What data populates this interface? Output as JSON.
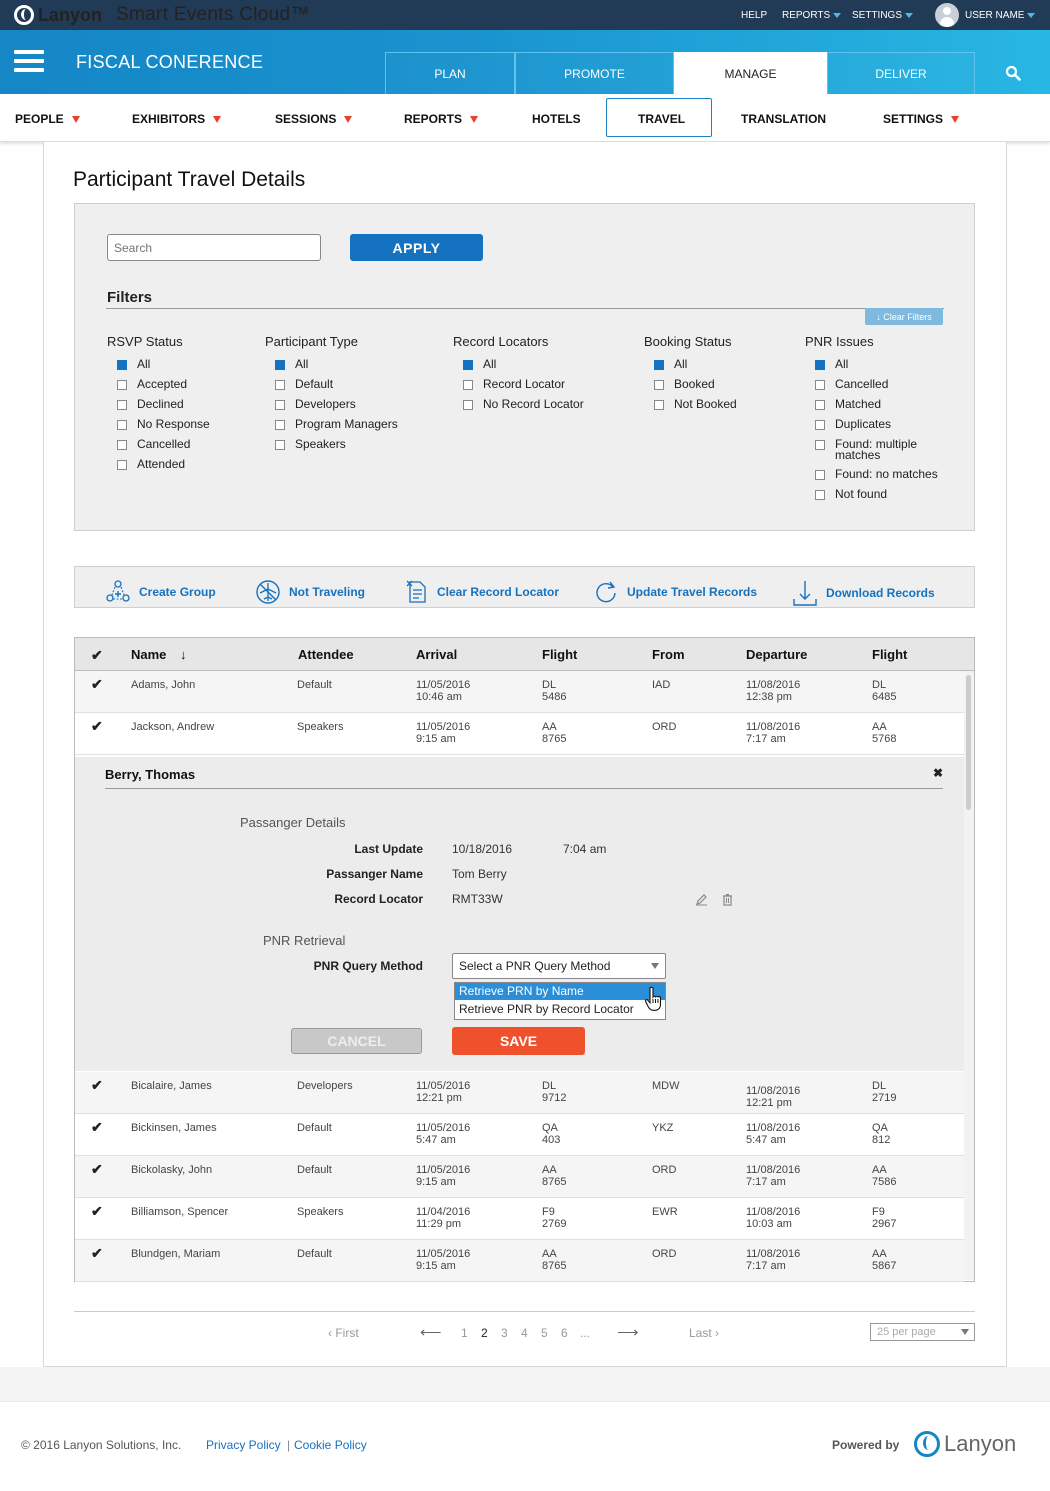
{
  "topbar": {
    "brand": "Lanyon",
    "product": "Smart Events Cloud™",
    "help": "HELP",
    "reports": "REPORTS",
    "settings": "SETTINGS",
    "user": "USER NAME"
  },
  "header": {
    "event_title": "FISCAL CONERENCE",
    "tabs": [
      {
        "label": "PLAN"
      },
      {
        "label": "PROMOTE"
      },
      {
        "label": "MANAGE",
        "active": true
      },
      {
        "label": "DELIVER"
      }
    ]
  },
  "subnav": {
    "items": [
      {
        "label": "PEOPLE",
        "dropdown": true
      },
      {
        "label": "EXHIBITORS",
        "dropdown": true
      },
      {
        "label": "SESSIONS",
        "dropdown": true
      },
      {
        "label": "REPORTS",
        "dropdown": true
      },
      {
        "label": "HOTELS",
        "dropdown": false
      },
      {
        "label": "TRAVEL",
        "dropdown": false,
        "active": true
      },
      {
        "label": "TRANSLATION",
        "dropdown": false
      },
      {
        "label": "SETTINGS",
        "dropdown": true
      }
    ]
  },
  "page": {
    "title": "Participant Travel Details"
  },
  "search": {
    "placeholder": "Search",
    "apply_label": "APPLY"
  },
  "filters": {
    "heading": "Filters",
    "clear_label": "↓ Clear Filters",
    "groups": [
      {
        "title": "RSVP Status",
        "options": [
          {
            "label": "All",
            "checked": true
          },
          {
            "label": "Accepted"
          },
          {
            "label": "Declined"
          },
          {
            "label": "No Response"
          },
          {
            "label": "Cancelled"
          },
          {
            "label": "Attended"
          }
        ]
      },
      {
        "title": "Participant Type",
        "options": [
          {
            "label": "All",
            "checked": true
          },
          {
            "label": "Default"
          },
          {
            "label": "Developers"
          },
          {
            "label": "Program Managers"
          },
          {
            "label": "Speakers"
          }
        ]
      },
      {
        "title": "Record Locators",
        "options": [
          {
            "label": "All",
            "checked": true
          },
          {
            "label": "Record Locator"
          },
          {
            "label": "No Record Locator"
          }
        ]
      },
      {
        "title": "Booking Status",
        "options": [
          {
            "label": "All",
            "checked": true
          },
          {
            "label": "Booked"
          },
          {
            "label": "Not Booked"
          }
        ]
      },
      {
        "title": "PNR Issues",
        "options": [
          {
            "label": "All",
            "checked": true
          },
          {
            "label": "Cancelled"
          },
          {
            "label": "Matched"
          },
          {
            "label": "Duplicates"
          },
          {
            "label": "Found: multiple matches"
          },
          {
            "label": "Found: no matches"
          },
          {
            "label": "Not found"
          }
        ]
      }
    ]
  },
  "actions": {
    "create_group": "Create Group",
    "not_traveling": "Not Traveling",
    "clear_record_locator": "Clear Record Locator",
    "update_travel_records": "Update Travel Records",
    "download_records": "Download Records"
  },
  "table": {
    "check_glyph": "✔",
    "columns": {
      "name": "Name",
      "attendee": "Attendee",
      "arrival": "Arrival",
      "flight": "Flight",
      "from": "From",
      "departure": "Departure",
      "flight2": "Flight"
    },
    "rows_top": [
      {
        "name": "Adams, John",
        "attendee": "Default",
        "arr_date": "11/05/2016",
        "arr_time": "10:46 am",
        "flt_code": "DL",
        "flt_num": "5486",
        "from": "IAD",
        "dep_date": "11/08/2016",
        "dep_time": "12:38 pm",
        "flt2_code": "DL",
        "flt2_num": "6485"
      },
      {
        "name": "Jackson, Andrew",
        "attendee": "Speakers",
        "arr_date": "11/05/2016",
        "arr_time": "9:15 am",
        "flt_code": "AA",
        "flt_num": "8765",
        "from": "ORD",
        "dep_date": "11/08/2016",
        "dep_time": "7:17 am",
        "flt2_code": "AA",
        "flt2_num": "5768"
      }
    ],
    "rows_bottom": [
      {
        "name": "Bicalaire, James",
        "attendee": "Developers",
        "arr_date": "11/05/2016",
        "arr_time": "12:21 pm",
        "flt_code": "DL",
        "flt_num": "9712",
        "from": "MDW",
        "dep_date": "11/08/2016",
        "dep_time": "12:21 pm",
        "flt2_code": "DL",
        "flt2_num": "2719"
      },
      {
        "name": "Bickinsen, James",
        "attendee": "Default",
        "arr_date": "11/05/2016",
        "arr_time": "5:47 am",
        "flt_code": "QA",
        "flt_num": "403",
        "from": "YKZ",
        "dep_date": "11/08/2016",
        "dep_time": "5:47 am",
        "flt2_code": "QA",
        "flt2_num": "812"
      },
      {
        "name": "Bickolasky, John",
        "attendee": "Default",
        "arr_date": "11/05/2016",
        "arr_time": "9:15 am",
        "flt_code": "AA",
        "flt_num": "8765",
        "from": "ORD",
        "dep_date": "11/08/2016",
        "dep_time": "7:17 am",
        "flt2_code": "AA",
        "flt2_num": "7586"
      },
      {
        "name": "Billiamson, Spencer",
        "attendee": "Speakers",
        "arr_date": "11/04/2016",
        "arr_time": "11:29 pm",
        "flt_code": "F9",
        "flt_num": "2769",
        "from": "EWR",
        "dep_date": "11/08/2016",
        "dep_time": "10:03 am",
        "flt2_code": "F9",
        "flt2_num": "2967"
      },
      {
        "name": "Blundgen, Mariam",
        "attendee": "Default",
        "arr_date": "11/05/2016",
        "arr_time": "9:15 am",
        "flt_code": "AA",
        "flt_num": "8765",
        "from": "ORD",
        "dep_date": "11/08/2016",
        "dep_time": "7:17 am",
        "flt2_code": "AA",
        "flt2_num": "5867"
      }
    ]
  },
  "detail": {
    "name": "Berry, Thomas",
    "close_glyph": "✖",
    "passenger_heading": "Passanger Details",
    "last_update_label": "Last Update",
    "last_update_date": "10/18/2016",
    "last_update_time": "7:04 am",
    "passenger_name_label": "Passanger Name",
    "passenger_name": "Tom Berry",
    "record_locator_label": "Record Locator",
    "record_locator": "RMT33W",
    "pnr_heading": "PNR Retrieval",
    "pnr_method_label": "PNR Query Method",
    "pnr_select_value": "Select a PNR Query Method",
    "pnr_options": [
      "Retrieve PRN by Name",
      "Retrieve PNR by Record Locator"
    ],
    "cancel_label": "CANCEL",
    "save_label": "SAVE"
  },
  "pagination": {
    "first": "First",
    "last": "Last",
    "pages": [
      "1",
      "2",
      "3",
      "4",
      "5",
      "6",
      "..."
    ],
    "current": "2",
    "per_page": "25 per page"
  },
  "footer": {
    "copyright": "© 2016 Lanyon Solutions, Inc.",
    "privacy": "Privacy Policy",
    "separator": "|",
    "cookie": "Cookie Policy",
    "powered_by": "Powered by",
    "logo_text": "Lanyon"
  },
  "colors": {
    "topbar": "#213a56",
    "accent": "#1572c0",
    "save": "#f0512d",
    "nav_caret": "#e8412c"
  }
}
